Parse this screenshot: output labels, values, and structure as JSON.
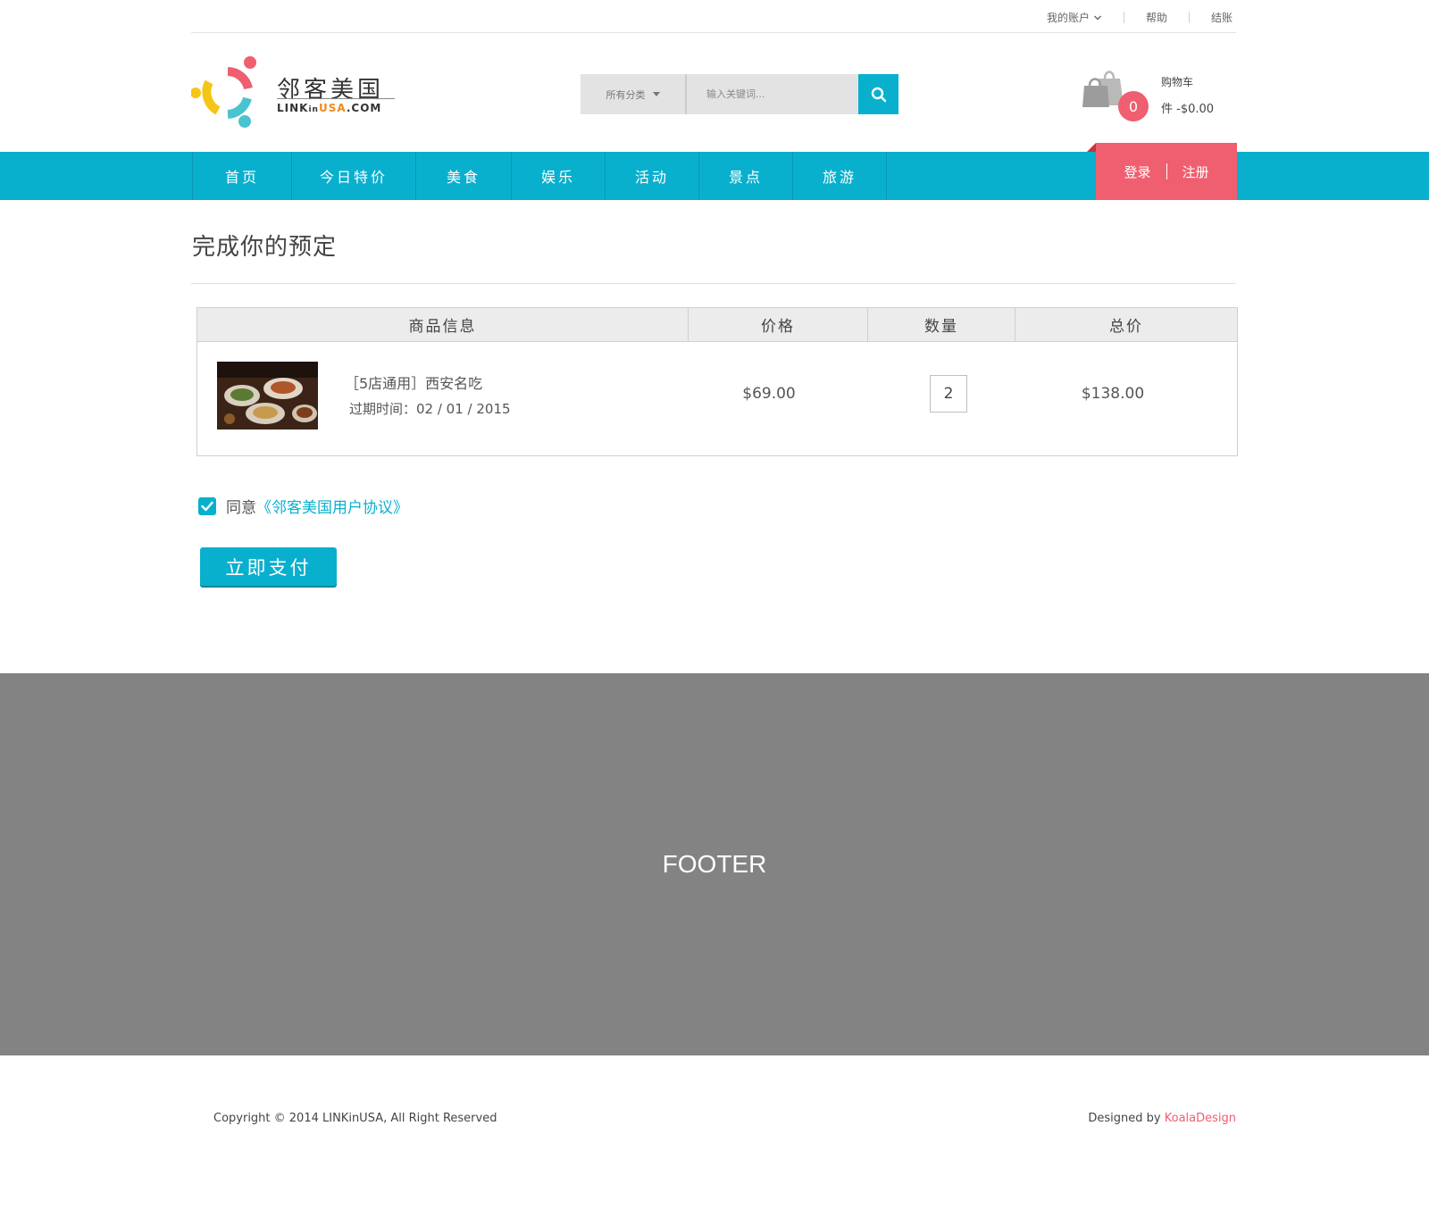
{
  "topbar": {
    "account": "我的账户",
    "help": "帮助",
    "checkout": "结账"
  },
  "logo": {
    "cn": "邻客美国",
    "en_prefix": "LINKinUSA",
    "en_link": "LINK",
    "en_in": "in",
    "en_usa": "USA",
    "en_suffix": ".COM"
  },
  "search": {
    "category": "所有分类",
    "placeholder": "输入关键词..."
  },
  "cart": {
    "count": "0",
    "label": "购物车",
    "summary": "件 -$0.00"
  },
  "nav": {
    "items": [
      "首页",
      "今日特价",
      "美食",
      "娱乐",
      "活动",
      "景点",
      "旅游"
    ]
  },
  "auth": {
    "login": "登录",
    "register": "注册"
  },
  "main": {
    "title": "完成你的预定",
    "columns": [
      "商品信息",
      "价格",
      "数量",
      "总价"
    ],
    "product": {
      "name": "［5店通用］西安名吃",
      "expiry": "过期时间：02 / 01 / 2015",
      "price": "$69.00",
      "quantity": "2",
      "total": "$138.00"
    },
    "agree_text": "同意",
    "agree_link": "《邻客美国用户协议》",
    "pay_button": "立即支付"
  },
  "footer": {
    "placeholder": "FOOTER",
    "copyright": "Copyright © 2014 LINKinUSA,  All Right Reserved",
    "designed_by": "Designed by ",
    "designer": "KoalaDesign"
  },
  "colors": {
    "accent": "#09b0ce",
    "brand_red": "#ef5f6f",
    "footer_bg": "#838383"
  },
  "icons": [
    "chevron-down-icon",
    "caret-down-icon",
    "search-icon",
    "shopping-bag-icon",
    "check-icon"
  ]
}
